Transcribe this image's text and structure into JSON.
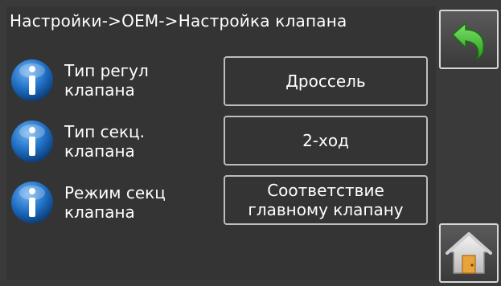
{
  "header": {
    "title": "Настройки->OEM->Настройка клапана"
  },
  "rows": [
    {
      "label_line1": "Тип регул",
      "label_line2": "клапана",
      "value_line1": "Дроссель",
      "value_line2": ""
    },
    {
      "label_line1": "Тип секц.",
      "label_line2": "клапана",
      "value_line1": "2-ход",
      "value_line2": ""
    },
    {
      "label_line1": "Режим секц",
      "label_line2": "клапана",
      "value_line1": "Соответствие",
      "value_line2": "главному клапану"
    }
  ],
  "icons": {
    "info": "info-icon",
    "back": "back-arrow-icon",
    "home": "home-icon"
  },
  "colors": {
    "background": "#343434",
    "info_blue": "#1f6fc4",
    "back_green": "#3cbf2a",
    "home_orange": "#e8a33a"
  }
}
